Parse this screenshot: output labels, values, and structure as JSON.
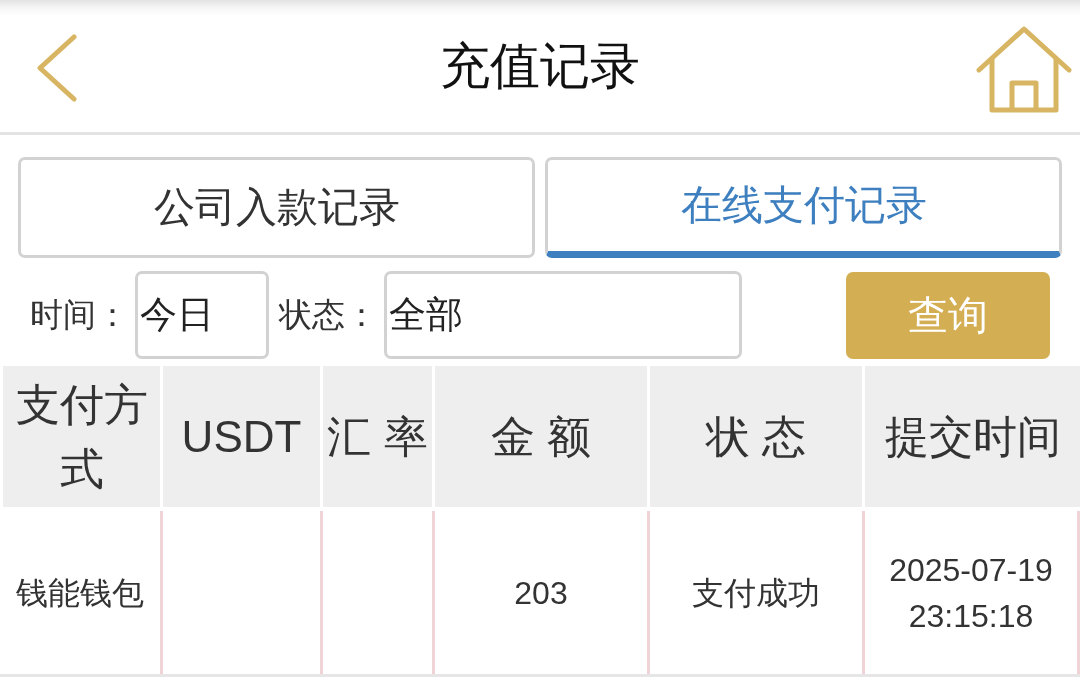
{
  "header": {
    "title": "充值记录"
  },
  "tabs": [
    {
      "label": "公司入款记录",
      "selected": false
    },
    {
      "label": "在线支付记录",
      "selected": true
    }
  ],
  "filters": {
    "time": {
      "label": "时间：",
      "value": "今日"
    },
    "status": {
      "label": "状态：",
      "value": "全部"
    },
    "button": "查询"
  },
  "table": {
    "columns": [
      "支付方式",
      "USDT",
      "汇 率",
      "金 额",
      "状 态",
      "提交时间"
    ],
    "rows": [
      {
        "cells": [
          {
            "text": "钱能钱包"
          },
          {},
          {},
          {
            "text": "203"
          },
          {
            "text": "支付成功"
          },
          {
            "text": "2025-07-19 23:15:18"
          }
        ]
      }
    ]
  }
}
